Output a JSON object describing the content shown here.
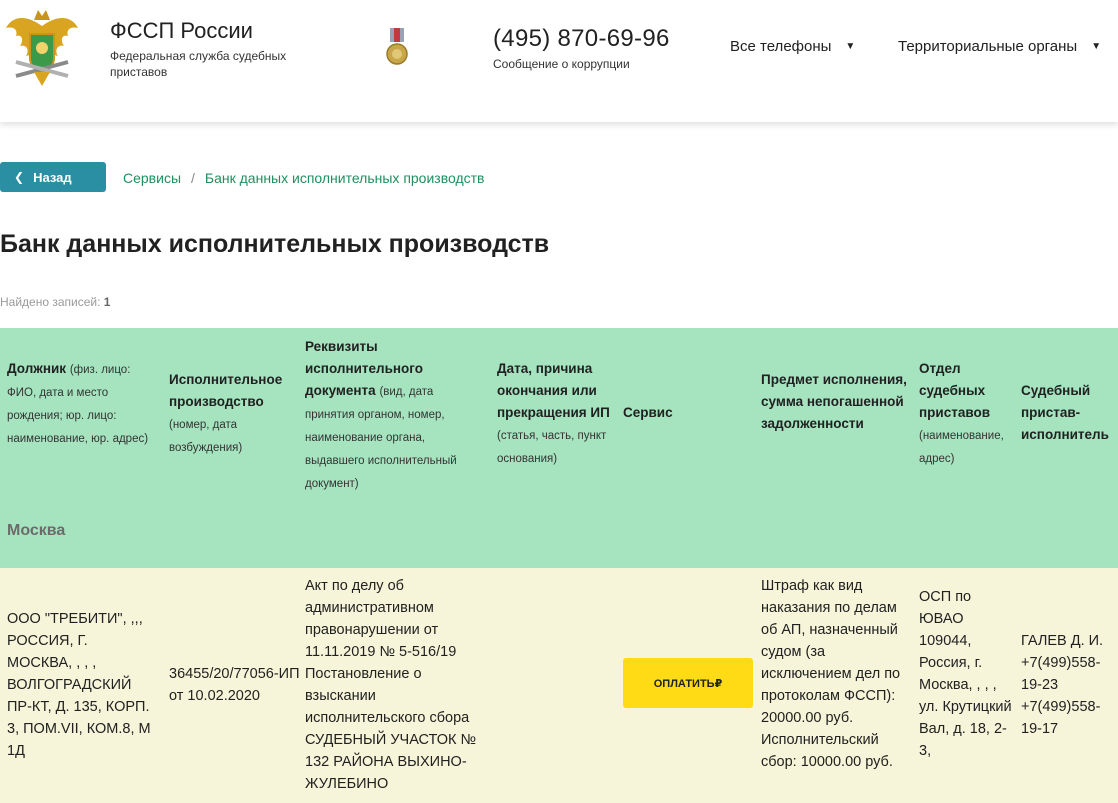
{
  "header": {
    "title": "ФССП России",
    "subtitle": "Федеральная служба судебных приставов",
    "phone": "(495) 870-69-96",
    "phone_caption": "Сообщение о коррупции",
    "nav": {
      "all_phones": "Все телефоны",
      "territorial": "Территориальные органы"
    }
  },
  "breadcrumb": {
    "back_label": "Назад",
    "items": [
      "Сервисы",
      "Банк данных исполнительных производств"
    ],
    "separator": "/"
  },
  "page": {
    "title": "Банк данных исполнительных производств",
    "found_label": "Найдено записей:",
    "found_count": "1"
  },
  "table": {
    "headers": [
      {
        "bold": "Должник",
        "small": "(физ. лицо: ФИО, дата и место рождения; юр. лицо: наименование, юр. адрес)"
      },
      {
        "bold": "Исполнительное производство",
        "small": "(номер, дата возбуждения)"
      },
      {
        "bold": "Реквизиты исполнительного документа",
        "small": "(вид, дата принятия органом, номер, наименование органа, выдавшего исполнительный документ)"
      },
      {
        "bold": "Дата, причина окончания или прекращения ИП",
        "small": "(статья, часть, пункт основания)"
      },
      {
        "bold": "Сервис",
        "small": ""
      },
      {
        "bold": "Предмет исполнения, сумма непогашенной задолженности",
        "small": ""
      },
      {
        "bold": "Отдел судебных приставов",
        "small": "(наименование, адрес)"
      },
      {
        "bold": "Судебный пристав-исполнитель",
        "small": ""
      }
    ],
    "region": "Москва",
    "row": {
      "debtor": "ООО \"ТРЕБИТИ\", ,,, РОССИЯ, Г. МОСКВА, , , , ВОЛГОГРАДСКИЙ ПР-КТ, Д. 135, КОРП. 3, ПОМ.VII, КОМ.8, М 1Д",
      "proceeding": "36455/20/77056-ИП от 10.02.2020",
      "document": "Акт по делу об административном правонарушении от 11.11.2019 № 5-516/19 Постановление о взыскании исполнительского сбора СУДЕБНЫЙ УЧАСТОК № 132 РАЙОНА ВЫХИНО-ЖУЛЕБИНО",
      "end_date": "",
      "pay_button": "ОПЛАТИТЬ₽",
      "subject": "Штраф как вид наказания по делам об АП, назначенный судом (за исключением дел по протоколам ФССП): 20000.00 руб. Исполнительский сбор: 10000.00 руб.",
      "department": "ОСП по ЮВАО 109044, Россия, г. Москва, , , , ул. Крутицкий Вал, д. 18, 2-3,",
      "bailiff": "ГАЛЕВ Д. И. +7(499)558-19-23 +7(499)558-19-17"
    }
  },
  "colors": {
    "header_green": "#a6e4c0",
    "row_bg": "#f7f5d9",
    "back_button": "#2a8fa3",
    "pay_button": "#ffdb15",
    "link": "#1f8f5f"
  }
}
